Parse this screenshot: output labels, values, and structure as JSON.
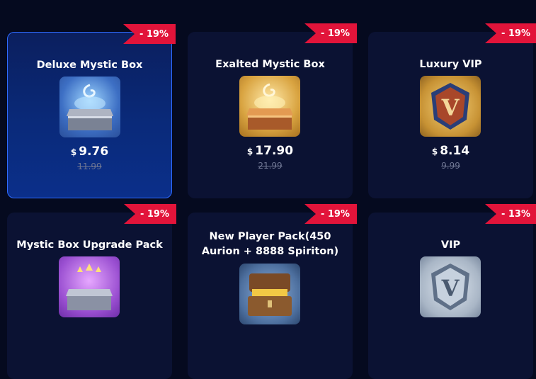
{
  "currency_symbol": "$",
  "colors": {
    "background": "#050a1f",
    "card": "#0b1233",
    "selected_card": "#0a2a7a",
    "badge": "#e2143a"
  },
  "products": [
    {
      "title": "Deluxe Mystic Box",
      "discount": "- 19%",
      "price": "9.76",
      "original_price": "11.99",
      "icon": "silver-mystic-box-icon",
      "selected": true
    },
    {
      "title": "Exalted Mystic Box",
      "discount": "- 19%",
      "price": "17.90",
      "original_price": "21.99",
      "icon": "golden-mystic-box-icon",
      "selected": false
    },
    {
      "title": "Luxury VIP",
      "discount": "- 19%",
      "price": "8.14",
      "original_price": "9.99",
      "icon": "luxury-vip-badge-icon",
      "selected": false
    },
    {
      "title": "Mystic Box Upgrade Pack",
      "discount": "- 19%",
      "icon": "upgrade-pack-box-icon",
      "selected": false
    },
    {
      "title_line1": "New Player Pack(450",
      "title_line2": "Aurion + 8888 Spiriton)",
      "discount": "- 19%",
      "icon": "treasure-chest-icon",
      "selected": false
    },
    {
      "title": "VIP",
      "discount": "- 13%",
      "icon": "vip-badge-icon",
      "selected": false
    }
  ]
}
